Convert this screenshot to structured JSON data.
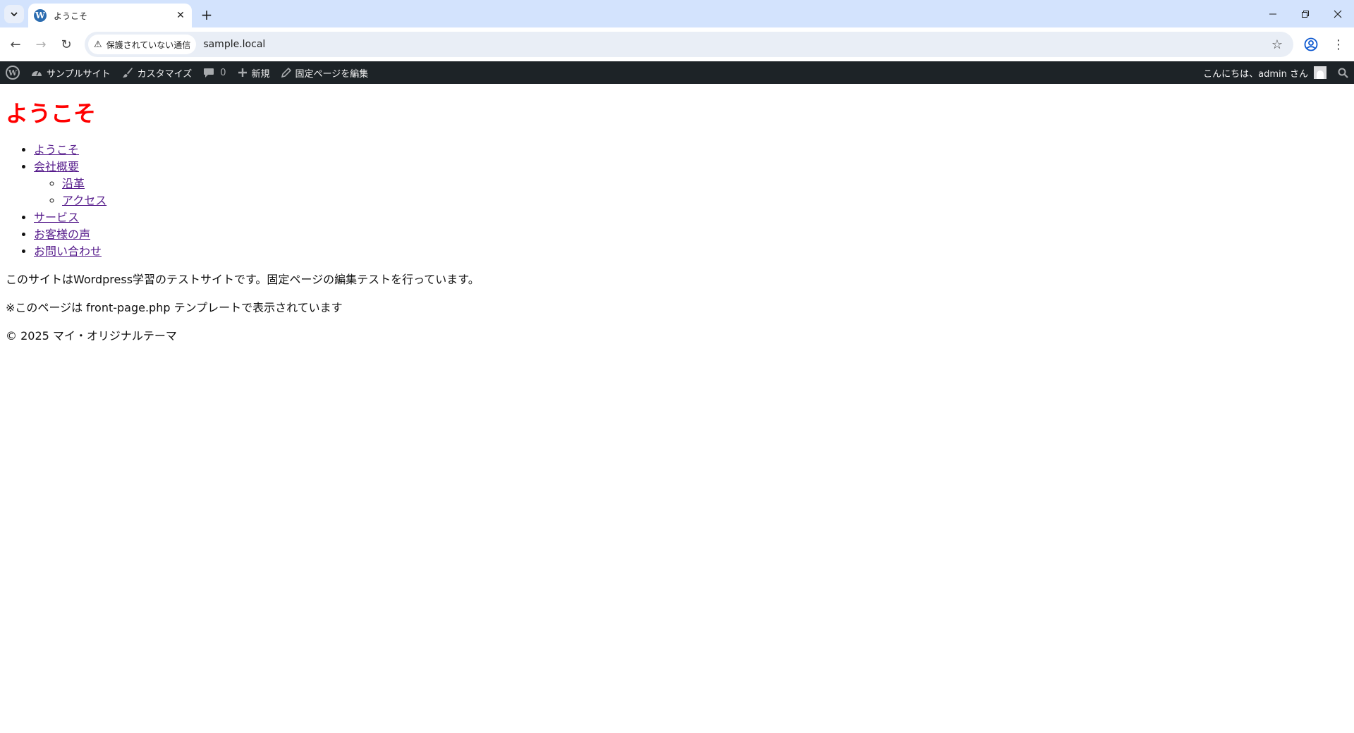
{
  "browser": {
    "tab": {
      "favicon": "W",
      "title": "ようこそ",
      "close_icon": "✕"
    },
    "new_tab_icon": "+",
    "window_controls": {
      "minimize": "—",
      "restore": "❐",
      "close": "✕"
    },
    "toolbar": {
      "back_icon": "←",
      "forward_icon": "→",
      "reload_icon": "↻",
      "security_icon": "⚠",
      "security_label": "保護されていない通信",
      "url": "sample.local",
      "bookmark_icon": "☆",
      "menu_icon": "⋮"
    }
  },
  "admin_bar": {
    "wp_logo": "W",
    "site_name": "サンプルサイト",
    "customize": "カスタマイズ",
    "comments_count": "0",
    "new_label": "新規",
    "edit_page": "固定ページを編集",
    "greeting": "こんにちは、admin さん",
    "icons": {
      "dashboard": "dashboard-icon",
      "customize": "brush-icon",
      "comments": "comment-icon",
      "new": "plus-icon",
      "edit": "pencil-icon",
      "search": "search-icon"
    }
  },
  "page": {
    "title": "ようこそ",
    "title_color": "#ff0000",
    "menu": [
      {
        "label": "ようこそ"
      },
      {
        "label": "会社概要",
        "children": [
          {
            "label": "沿革"
          },
          {
            "label": "アクセス"
          }
        ]
      },
      {
        "label": "サービス"
      },
      {
        "label": "お客様の声"
      },
      {
        "label": "お問い合わせ"
      }
    ],
    "paragraph_1": "このサイトはWordpress学習のテストサイトです。固定ページの編集テストを行っています。",
    "paragraph_2": "※このページは front-page.php テンプレートで表示されています",
    "footer": "© 2025 マイ・オリジナルテーマ"
  }
}
